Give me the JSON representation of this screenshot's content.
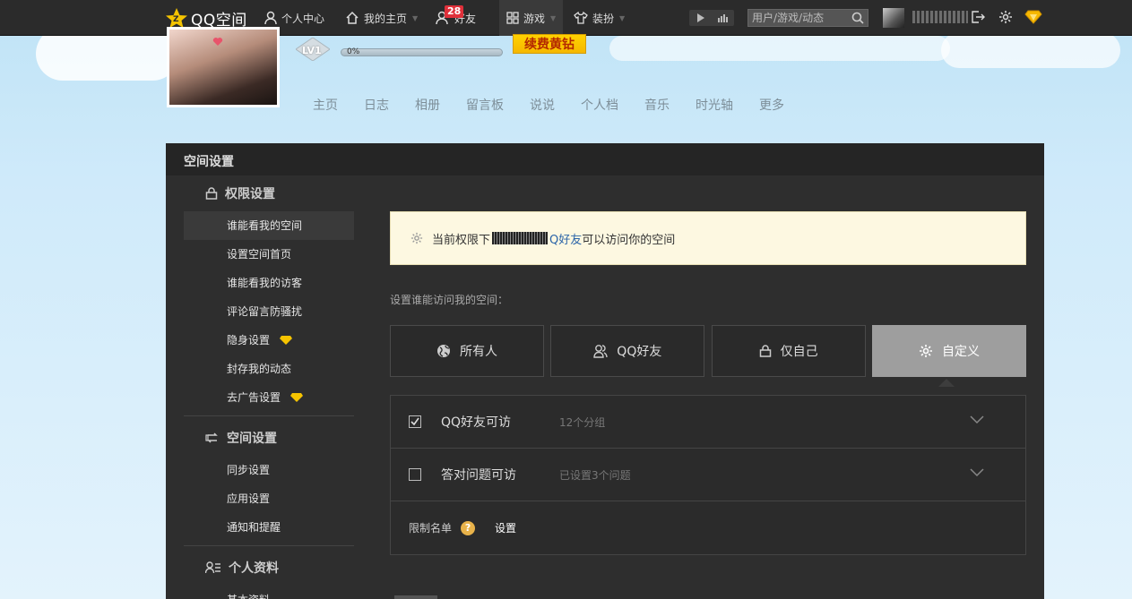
{
  "topbar": {
    "logo_text": "QQ空间",
    "nav": [
      {
        "label": "个人中心",
        "icon": "user-icon"
      },
      {
        "label": "我的主页",
        "icon": "home-icon"
      },
      {
        "label": "好友",
        "icon": "friends-icon",
        "badge": "28"
      },
      {
        "label": "游戏",
        "icon": "grid-icon"
      },
      {
        "label": "装扮",
        "icon": "tshirt-icon"
      }
    ],
    "search_placeholder": "用户/游戏/动态"
  },
  "profile": {
    "level": "LV1",
    "progress_label": "0%",
    "progress_value": 0,
    "renew_label": "续费黄钻",
    "tabs": [
      "主页",
      "日志",
      "相册",
      "留言板",
      "说说",
      "个人档",
      "音乐",
      "时光轴",
      "更多"
    ]
  },
  "panel": {
    "title": "空间设置",
    "sidebar": {
      "groups": [
        {
          "label": "权限设置",
          "icon": "lock-icon",
          "items": [
            "谁能看我的空间",
            "设置空间首页",
            "谁能看我的访客",
            "评论留言防骚扰",
            "隐身设置",
            "封存我的动态",
            "去广告设置"
          ]
        },
        {
          "label": "空间设置",
          "icon": "sync-icon",
          "items": [
            "同步设置",
            "应用设置",
            "通知和提醒"
          ]
        },
        {
          "label": "个人资料",
          "icon": "profile-icon",
          "items": [
            "基本资料"
          ]
        }
      ]
    },
    "notice": {
      "prefix": "当前权限下",
      "link": "Q好友",
      "suffix": "可以访问你的空间"
    },
    "section_label": "设置谁能访问我的空间：",
    "options": [
      {
        "label": "所有人",
        "icon": "globe-icon"
      },
      {
        "label": "QQ好友",
        "icon": "friends-icon"
      },
      {
        "label": "仅自己",
        "icon": "lock-icon"
      },
      {
        "label": "自定义",
        "icon": "gear-icon",
        "selected": true
      }
    ],
    "rules": [
      {
        "title": "QQ好友可访",
        "sub": "12个分组",
        "checked": true
      },
      {
        "title": "答对问题可访",
        "sub": "已设置3个问题",
        "checked": false
      }
    ],
    "limit": {
      "label": "限制名单",
      "help": "?",
      "link": "设置"
    }
  },
  "colors": {
    "accent_yellow": "#f6b800",
    "topbar": "#2b2b2b",
    "panel": "#2e2e2e",
    "selected": "#9e9e9e"
  }
}
